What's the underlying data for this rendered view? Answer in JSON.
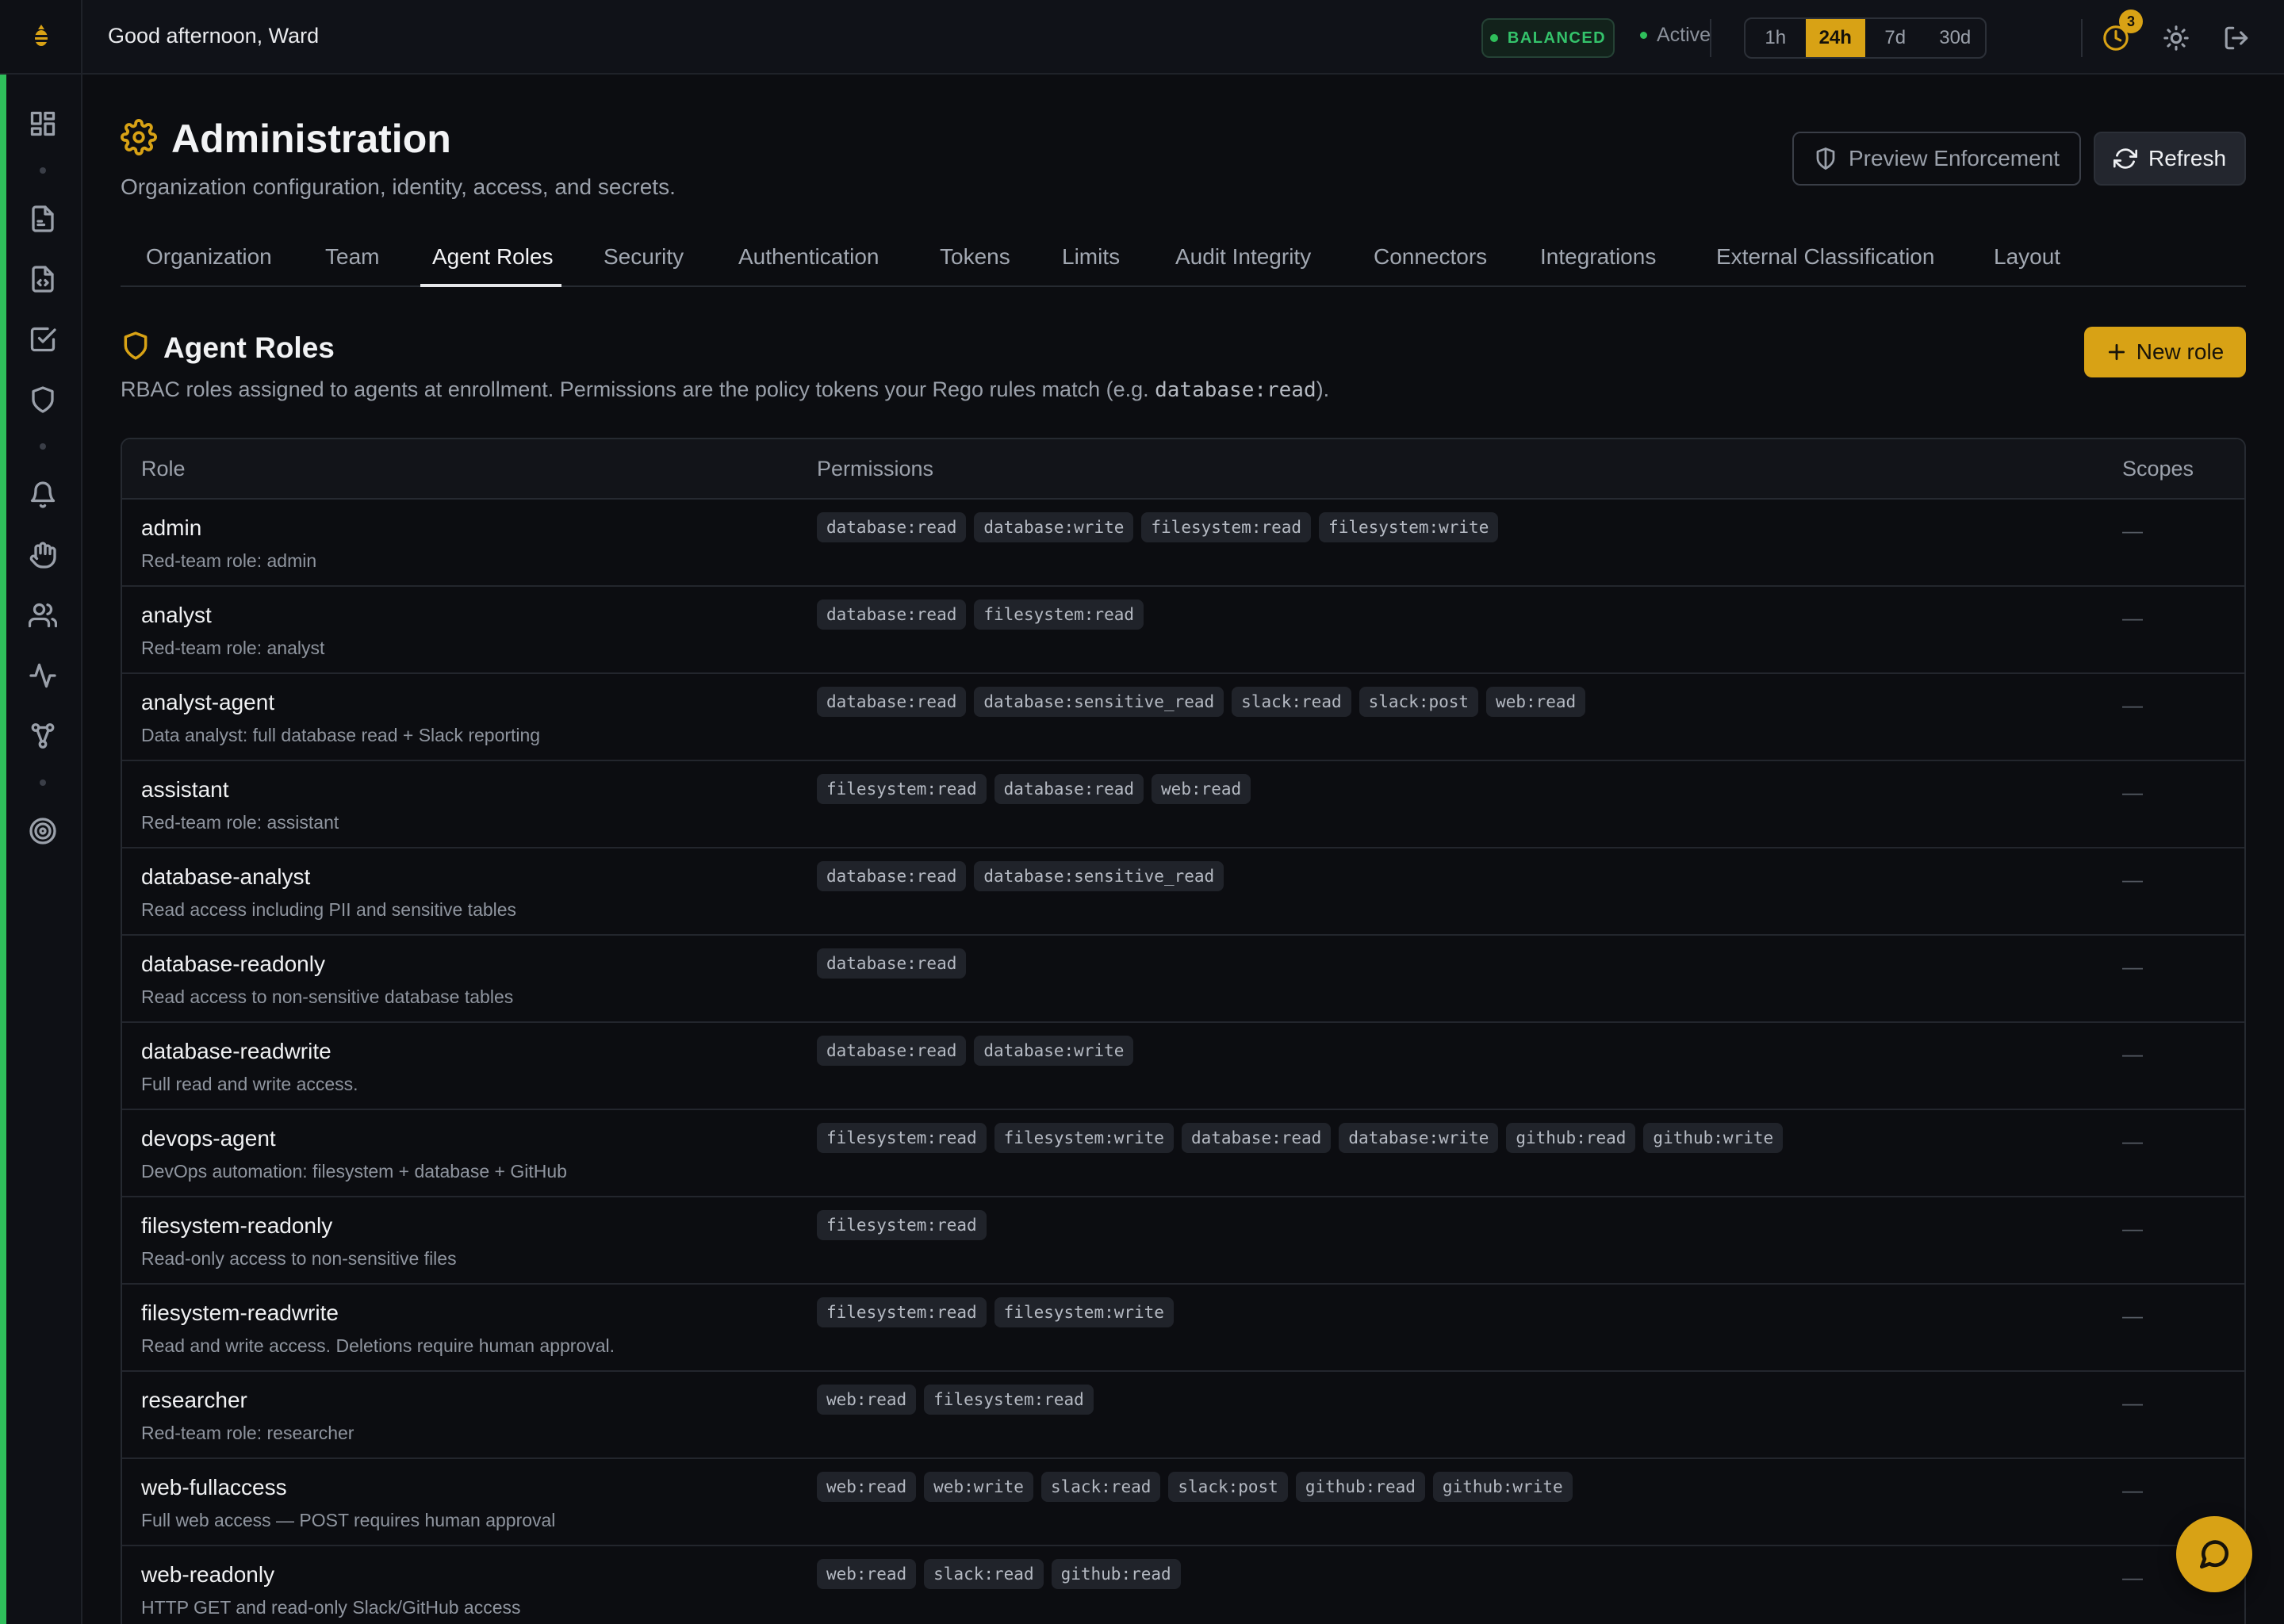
{
  "topbar": {
    "greeting": "Good afternoon, Ward",
    "mode_badge": "BALANCED",
    "status": "Active",
    "time_ranges": [
      "1h",
      "24h",
      "7d",
      "30d"
    ],
    "selected_range": "24h",
    "notification_count": "3",
    "icons": [
      "clock-icon",
      "sun-icon",
      "logout-icon"
    ]
  },
  "sidebar": {
    "logo_icon": "bee-logo-icon",
    "items": [
      {
        "icon": "dashboard-icon"
      },
      {
        "icon": "file-audit-icon"
      },
      {
        "icon": "file-code-icon"
      },
      {
        "icon": "checkbox-icon"
      },
      {
        "icon": "shield-icon"
      },
      {
        "icon": "bell-icon"
      },
      {
        "icon": "hand-icon"
      },
      {
        "icon": "users-icon"
      },
      {
        "icon": "activity-icon"
      },
      {
        "icon": "graph-icon"
      },
      {
        "icon": "target-icon"
      }
    ]
  },
  "page": {
    "title": "Administration",
    "subtitle": "Organization configuration, identity, access, and secrets.",
    "preview_button": "Preview Enforcement",
    "refresh_button": "Refresh"
  },
  "tabs": [
    "Organization",
    "Team",
    "Agent Roles",
    "Security",
    "Authentication",
    "Tokens",
    "Limits",
    "Audit Integrity",
    "Connectors",
    "Integrations",
    "External Classification",
    "Layout"
  ],
  "active_tab": "Agent Roles",
  "section": {
    "title": "Agent Roles",
    "description_prefix": "RBAC roles assigned to agents at enrollment. Permissions are the policy tokens your Rego rules match (e.g. ",
    "description_code": "database:read",
    "description_suffix": ").",
    "new_role_button": "New role"
  },
  "table": {
    "columns": [
      "Role",
      "Permissions",
      "Scopes"
    ],
    "rows": [
      {
        "name": "admin",
        "description": "Red-team role: admin",
        "permissions": [
          "database:read",
          "database:write",
          "filesystem:read",
          "filesystem:write"
        ],
        "scopes": "—"
      },
      {
        "name": "analyst",
        "description": "Red-team role: analyst",
        "permissions": [
          "database:read",
          "filesystem:read"
        ],
        "scopes": "—"
      },
      {
        "name": "analyst-agent",
        "description": "Data analyst: full database read + Slack reporting",
        "permissions": [
          "database:read",
          "database:sensitive_read",
          "slack:read",
          "slack:post",
          "web:read"
        ],
        "scopes": "—"
      },
      {
        "name": "assistant",
        "description": "Red-team role: assistant",
        "permissions": [
          "filesystem:read",
          "database:read",
          "web:read"
        ],
        "scopes": "—"
      },
      {
        "name": "database-analyst",
        "description": "Read access including PII and sensitive tables",
        "permissions": [
          "database:read",
          "database:sensitive_read"
        ],
        "scopes": "—"
      },
      {
        "name": "database-readonly",
        "description": "Read access to non-sensitive database tables",
        "permissions": [
          "database:read"
        ],
        "scopes": "—"
      },
      {
        "name": "database-readwrite",
        "description": "Full read and write access.",
        "permissions": [
          "database:read",
          "database:write"
        ],
        "scopes": "—"
      },
      {
        "name": "devops-agent",
        "description": "DevOps automation: filesystem + database + GitHub",
        "permissions": [
          "filesystem:read",
          "filesystem:write",
          "database:read",
          "database:write",
          "github:read",
          "github:write"
        ],
        "scopes": "—"
      },
      {
        "name": "filesystem-readonly",
        "description": "Read-only access to non-sensitive files",
        "permissions": [
          "filesystem:read"
        ],
        "scopes": "—"
      },
      {
        "name": "filesystem-readwrite",
        "description": "Read and write access. Deletions require human approval.",
        "permissions": [
          "filesystem:read",
          "filesystem:write"
        ],
        "scopes": "—"
      },
      {
        "name": "researcher",
        "description": "Red-team role: researcher",
        "permissions": [
          "web:read",
          "filesystem:read"
        ],
        "scopes": "—"
      },
      {
        "name": "web-fullaccess",
        "description": "Full web access — POST requires human approval",
        "permissions": [
          "web:read",
          "web:write",
          "slack:read",
          "slack:post",
          "github:read",
          "github:write"
        ],
        "scopes": "—"
      },
      {
        "name": "web-readonly",
        "description": "HTTP GET and read-only Slack/GitHub access",
        "permissions": [
          "web:read",
          "slack:read",
          "github:read"
        ],
        "scopes": "—"
      }
    ]
  },
  "colors": {
    "accent": "#d8a215",
    "success": "#2fbf5b",
    "background": "#0c0d11"
  },
  "chat_button_icon": "chat-bubble-icon"
}
